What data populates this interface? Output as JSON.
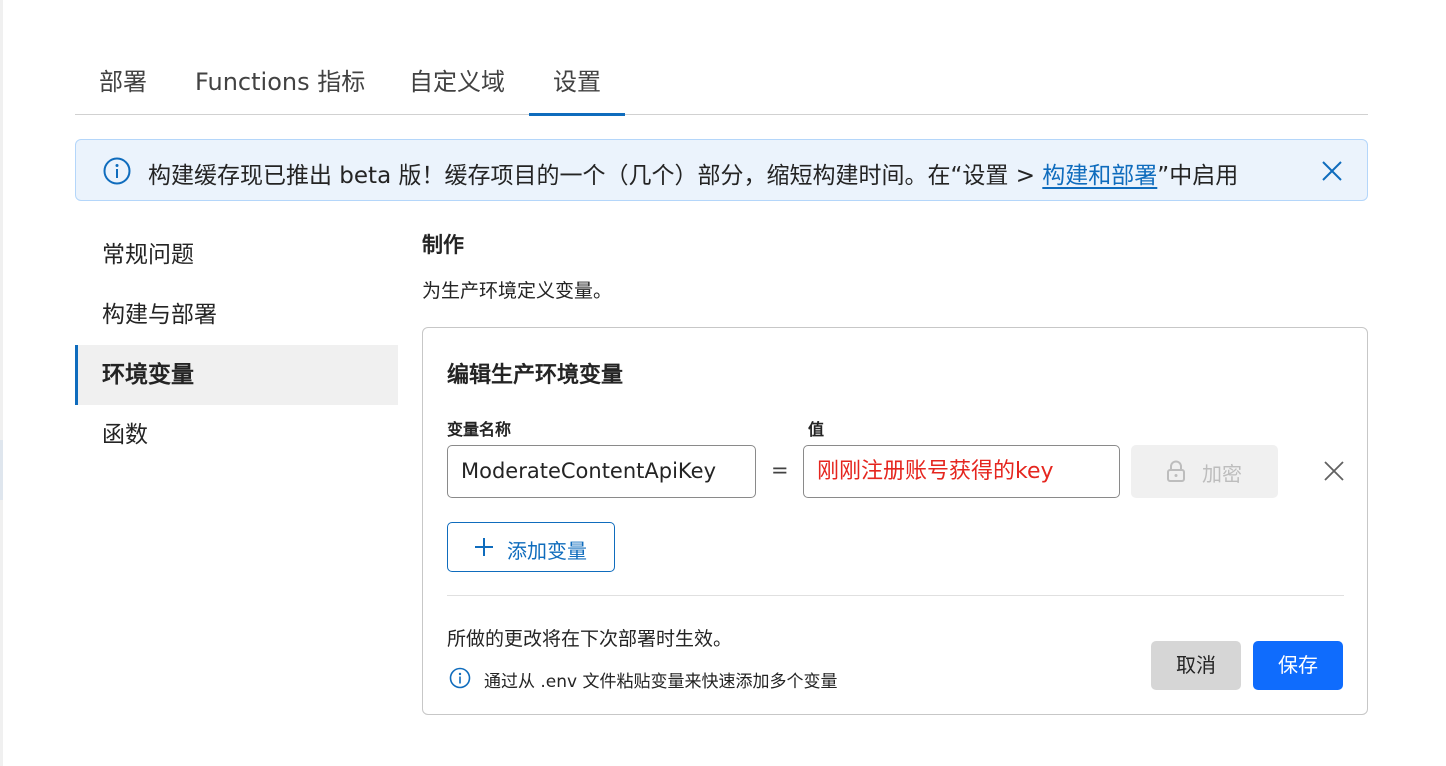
{
  "tabs": [
    {
      "label": "部署"
    },
    {
      "label": "Functions 指标"
    },
    {
      "label": "自定义域"
    },
    {
      "label": "设置",
      "active": true
    }
  ],
  "banner": {
    "text_before": "构建缓存现已推出 beta 版！缓存项目的一个（几个）部分，缩短构建时间。在“设置 > ",
    "link_text": "构建和部署",
    "text_after": "”中启用"
  },
  "sidenav": {
    "items": [
      {
        "label": "常规问题"
      },
      {
        "label": "构建与部署"
      },
      {
        "label": "环境变量",
        "active": true
      },
      {
        "label": "函数"
      }
    ]
  },
  "section": {
    "title": "制作",
    "description": "为生产环境定义变量。"
  },
  "card": {
    "title": "编辑生产环境变量",
    "name_label": "变量名称",
    "value_label": "值",
    "variable_name": "ModerateContentApiKey",
    "variable_value": "刚刚注册账号获得的key",
    "equals": "=",
    "encrypt_label": "加密",
    "add_label": "添加变量",
    "footer_note": "所做的更改将在下次部署时生效。",
    "tip": "通过从 .env 文件粘贴变量来快速添加多个变量",
    "cancel_label": "取消",
    "save_label": "保存"
  },
  "colors": {
    "accent": "#0f6cbd",
    "primary_button": "#0f6cfd",
    "value_text": "#e5261f",
    "banner_bg": "#ebf3fc"
  },
  "icons": [
    "info-icon",
    "close-icon",
    "lock-icon",
    "plus-icon",
    "remove-icon"
  ]
}
